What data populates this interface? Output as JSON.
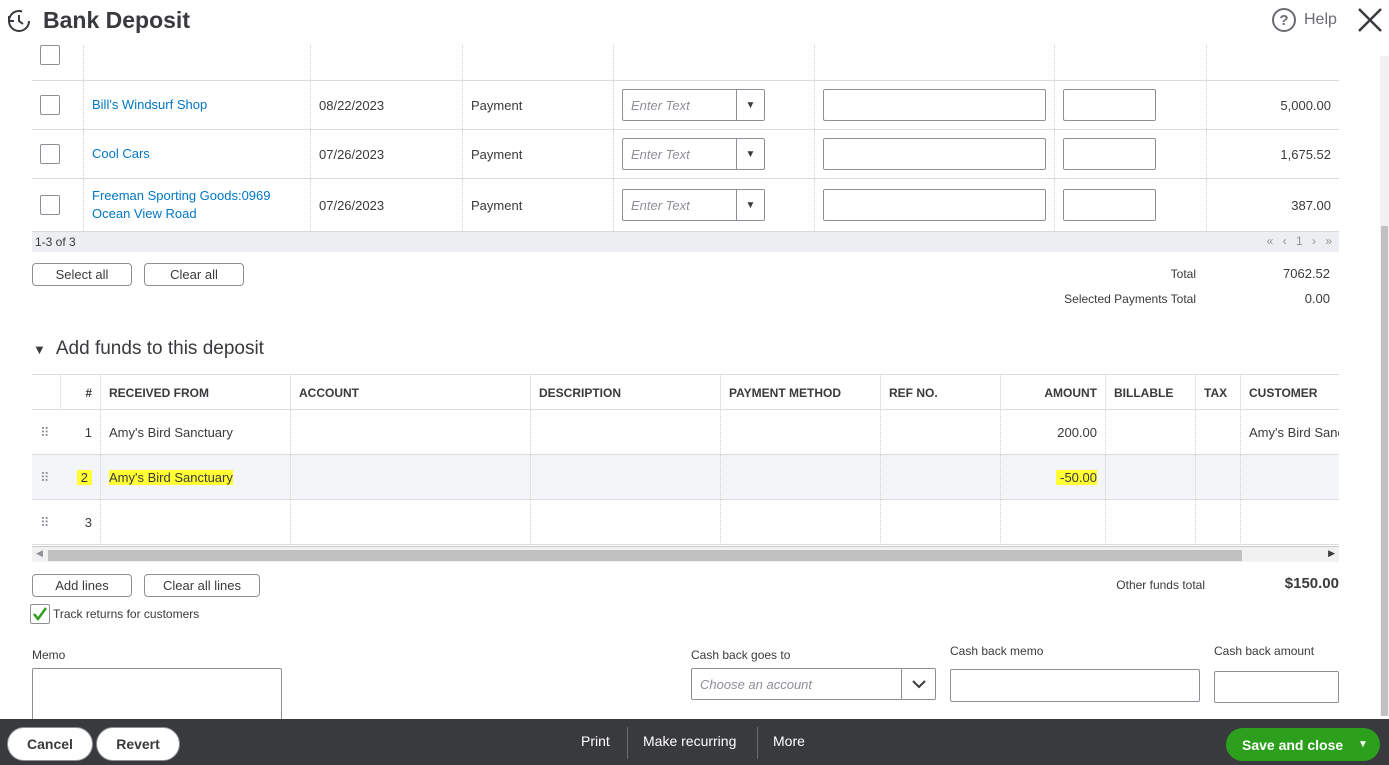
{
  "header": {
    "title": "Bank Deposit",
    "help_label": "Help"
  },
  "payments": {
    "rows": [
      {
        "received_from": "Bill's Windsurf Shop",
        "date": "08/22/2023",
        "type": "Payment",
        "payment_method_placeholder": "Enter Text",
        "amount": "5,000.00"
      },
      {
        "received_from": "Cool Cars",
        "date": "07/26/2023",
        "type": "Payment",
        "payment_method_placeholder": "Enter Text",
        "amount": "1,675.52"
      },
      {
        "received_from": "Freeman Sporting Goods:0969 Ocean View Road",
        "date": "07/26/2023",
        "type": "Payment",
        "payment_method_placeholder": "Enter Text",
        "amount": "387.00"
      }
    ],
    "pager_text": "1-3 of 3",
    "pager_nav": "« ‹ 1 › »",
    "select_all_label": "Select all",
    "clear_all_label": "Clear all",
    "total_label": "Total",
    "total_value": "7062.52",
    "selected_total_label": "Selected Payments Total",
    "selected_total_value": "0.00"
  },
  "funds": {
    "section_title": "Add funds to this deposit",
    "columns": {
      "num": "#",
      "received_from": "RECEIVED FROM",
      "account": "ACCOUNT",
      "description": "DESCRIPTION",
      "payment_method": "PAYMENT METHOD",
      "ref_no": "REF NO.",
      "amount": "AMOUNT",
      "billable": "BILLABLE",
      "tax": "TAX",
      "customer": "CUSTOMER"
    },
    "rows": [
      {
        "num": "1",
        "received_from": "Amy's Bird Sanctuary",
        "amount": "200.00",
        "customer": "Amy's Bird Sanctuary"
      },
      {
        "num": "2",
        "received_from": "Amy's Bird Sanctuary",
        "amount": "-50.00",
        "customer": ""
      },
      {
        "num": "3",
        "received_from": "",
        "amount": "",
        "customer": ""
      }
    ],
    "add_lines_label": "Add lines",
    "clear_all_lines_label": "Clear all lines",
    "other_funds_label": "Other funds total",
    "other_funds_value": "$150.00",
    "track_returns_label": "Track returns for customers",
    "track_returns_checked": true
  },
  "bottom_form": {
    "memo_label": "Memo",
    "cash_back_goes_to_label": "Cash back goes to",
    "cash_back_goes_to_placeholder": "Choose an account",
    "cash_back_memo_label": "Cash back memo",
    "cash_back_amount_label": "Cash back amount"
  },
  "footer": {
    "cancel_label": "Cancel",
    "revert_label": "Revert",
    "print_label": "Print",
    "make_recurring_label": "Make recurring",
    "more_label": "More",
    "save_label": "Save and close"
  },
  "colors": {
    "brand_green": "#2ca01c",
    "link_blue": "#0077c5",
    "highlight": "#ffff33",
    "footer_bg": "#393a3d"
  }
}
